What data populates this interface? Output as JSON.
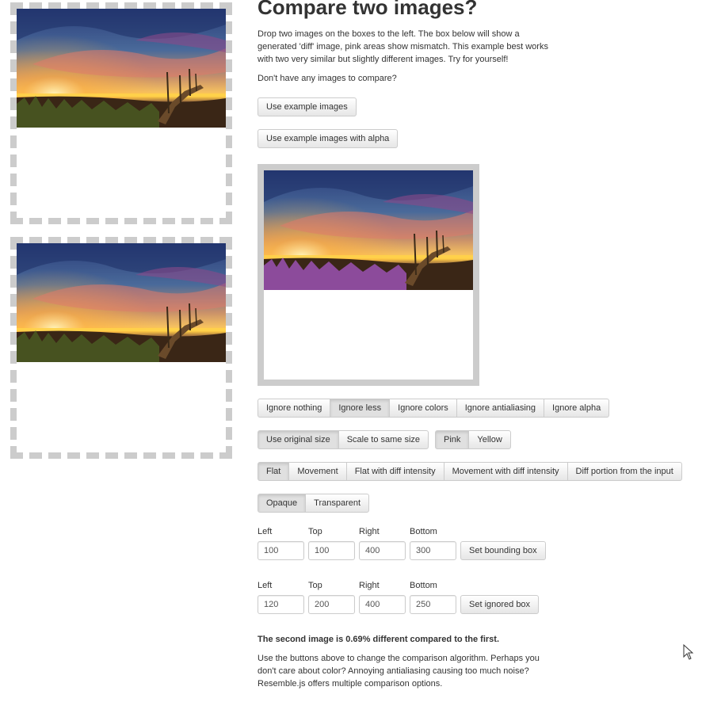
{
  "header": {
    "title": "Compare two images?"
  },
  "intro": "Drop two images on the boxes to the left. The box below will show a generated 'diff' image, pink areas show mismatch. This example best works with two very similar but slightly different images. Try for yourself!",
  "no_images_prompt": "Don't have any images to compare?",
  "buttons": {
    "use_example": "Use example images",
    "use_example_alpha": "Use example images with alpha",
    "set_bounding_box": "Set bounding box",
    "set_ignored_box": "Set ignored box"
  },
  "ignore_options": {
    "items": [
      "Ignore nothing",
      "Ignore less",
      "Ignore colors",
      "Ignore antialiasing",
      "Ignore alpha"
    ],
    "active": "Ignore less"
  },
  "size_options": {
    "items": [
      "Use original size",
      "Scale to same size"
    ],
    "active": "Use original size"
  },
  "color_options": {
    "items": [
      "Pink",
      "Yellow"
    ],
    "active": "Pink"
  },
  "diff_modes": {
    "items": [
      "Flat",
      "Movement",
      "Flat with diff intensity",
      "Movement with diff intensity",
      "Diff portion from the input"
    ],
    "active": "Flat"
  },
  "opacity_options": {
    "items": [
      "Opaque",
      "Transparent"
    ],
    "active": "Opaque"
  },
  "bounding_box": {
    "labels": [
      "Left",
      "Top",
      "Right",
      "Bottom"
    ],
    "values": [
      "100",
      "100",
      "400",
      "300"
    ]
  },
  "ignored_box": {
    "labels": [
      "Left",
      "Top",
      "Right",
      "Bottom"
    ],
    "values": [
      "120",
      "200",
      "400",
      "250"
    ]
  },
  "result": {
    "summary": "The second image is 0.69% different compared to the first.",
    "advice": "Use the buttons above to change the comparison algorithm. Perhaps you don't care about color? Annoying antialiasing causing too much noise? Resemble.js offers multiple comparison options."
  },
  "colors": {
    "dropzone_border": "#cccccc",
    "button_border": "#cccccc",
    "text": "#333333",
    "active_button": "#e0e0e0"
  },
  "icons": {
    "pointer": "mouse-pointer-icon"
  }
}
